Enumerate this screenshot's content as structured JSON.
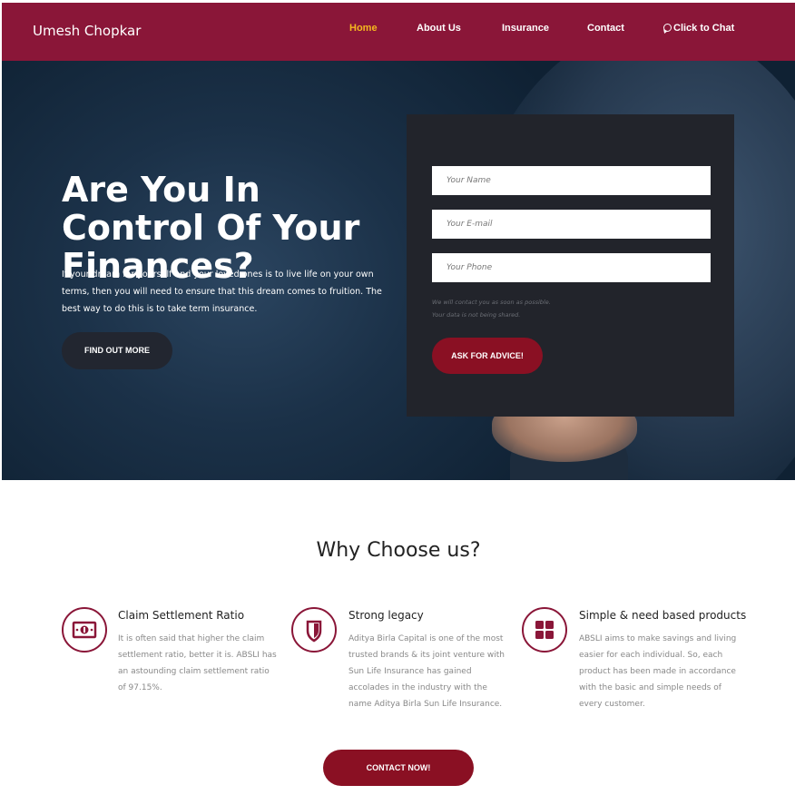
{
  "nav": {
    "brand": "Umesh Chopkar",
    "links": [
      "Home",
      "About Us",
      "Insurance",
      "Contact",
      "Click to Chat"
    ],
    "active_color": "#f5b81f",
    "bar_color": "#8a1638"
  },
  "hero": {
    "title": "Are You In Control Of Your Finances?",
    "text": "If your dream for yourself and your loved ones is to live life on your own terms, then you will need to ensure that this dream comes to fruition. The best way to do this is to take term insurance.",
    "button": "FIND OUT MORE"
  },
  "form": {
    "name_placeholder": "Your Name",
    "email_placeholder": "Your E-mail",
    "phone_placeholder": "Your Phone",
    "note_1": "We will contact you as soon as possible.",
    "note_2": "Your data is not being shared.",
    "button": "ASK FOR ADVICE!"
  },
  "why": {
    "title": "Why Choose us?",
    "features": [
      {
        "icon": "money-icon",
        "title": "Claim Settlement Ratio",
        "text": "It is often said that higher the claim settlement ratio, better it is. ABSLI has an astounding claim settlement ratio of 97.15%."
      },
      {
        "icon": "shield-icon",
        "title": "Strong legacy",
        "text": "Aditya Birla Capital is one of the most trusted brands & its joint venture with Sun Life Insurance has gained accolades in the industry with the name Aditya Birla Sun Life Insurance."
      },
      {
        "icon": "grid-icon",
        "title": "Simple & need based products",
        "text": "ABSLI aims to make savings and living easier for each individual. So, each product has been made in accordance with the basic and simple needs of every customer."
      }
    ],
    "contact_button": "CONTACT NOW!"
  }
}
